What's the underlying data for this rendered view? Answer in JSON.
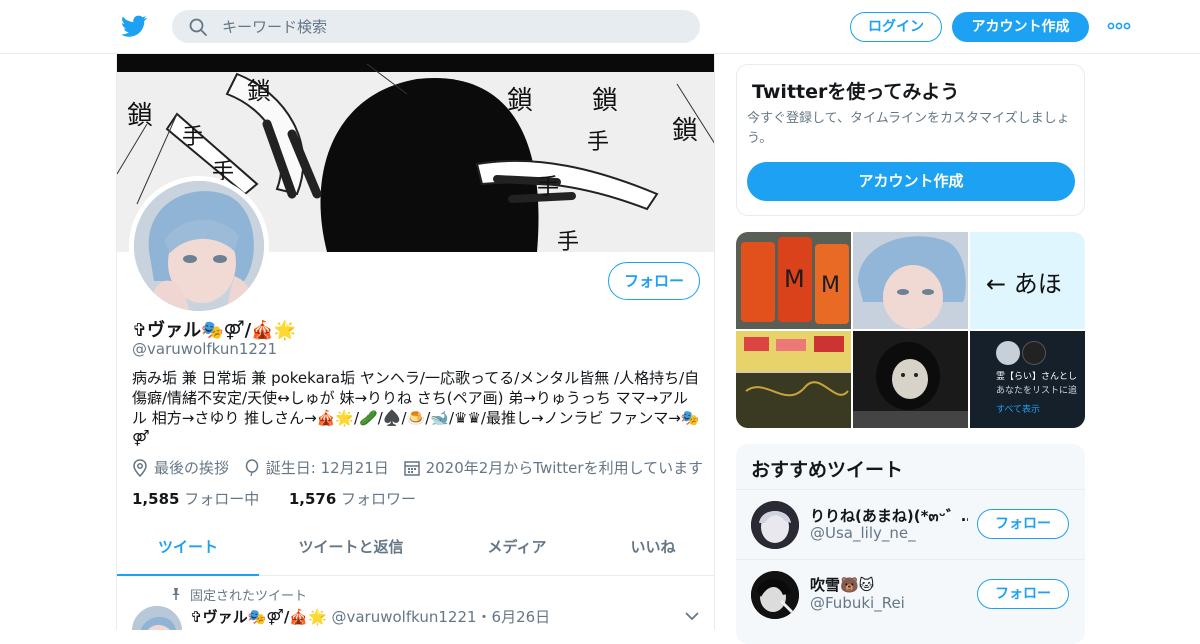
{
  "header": {
    "search_placeholder": "キーワード検索",
    "login_label": "ログイン",
    "signup_label": "アカウント作成"
  },
  "profile": {
    "follow_label": "フォロー",
    "name": "✞ヴァル🎭⚤/🎪🌟",
    "handle": "@varuwolfkun1221",
    "bio": "病み垢 兼 日常垢 兼 pokekara垢 ヤンヘラ/一応歌ってる/メンタル皆無 /人格持ち/自傷癖/情緒不安定/天使↔しゅが 妹→りりね さち(ペア画) 弟→りゅうっち ママ→アルル 相方→さゆり 推しさん→🎪🌟/🥒/♠️/🍮/🐋/♛♛/最推し→ノンラビ ファンマ→🎭⚤",
    "location": "最後の挨拶",
    "birthday": "誕生日: 12月21日",
    "joined": "2020年2月からTwitterを利用しています",
    "following_count": "1,585",
    "following_label": "フォロー中",
    "followers_count": "1,576",
    "followers_label": "フォロワー"
  },
  "tabs": [
    {
      "label": "ツイート",
      "active": true
    },
    {
      "label": "ツイートと返信",
      "active": false
    },
    {
      "label": "メディア",
      "active": false
    },
    {
      "label": "いいね",
      "active": false
    }
  ],
  "pinned_tweet": {
    "pinned_label": "固定されたツイート",
    "name": "✞ヴァル🎭⚤/🎪🌟",
    "handle_date": "@varuwolfkun1221・6月26日"
  },
  "sidebar": {
    "signup_card": {
      "title": "Twitterを使ってみよう",
      "subtitle": "今すぐ登録して、タイムラインをカスタマイズしましょう。",
      "cta": "アカウント作成"
    },
    "media_grid": {
      "cell_texts": [
        "← あほ",
        "霊【らい】さんとし",
        "あなたをリストに追",
        "すべて表示"
      ]
    },
    "recommend": {
      "title": "おすすめツイート",
      "users": [
        {
          "name": "りりね(あまね)(*๓ᵕ゛…",
          "handle": "@Usa_lily_ne_",
          "follow": "フォロー"
        },
        {
          "name": "吹雪🐻🐱",
          "handle": "@Fubuki_Rei",
          "follow": "フォロー"
        }
      ]
    }
  },
  "colors": {
    "accent": "#1da1f2",
    "text_primary": "#14171a",
    "text_secondary": "#657786",
    "border": "#e6ecf0"
  }
}
